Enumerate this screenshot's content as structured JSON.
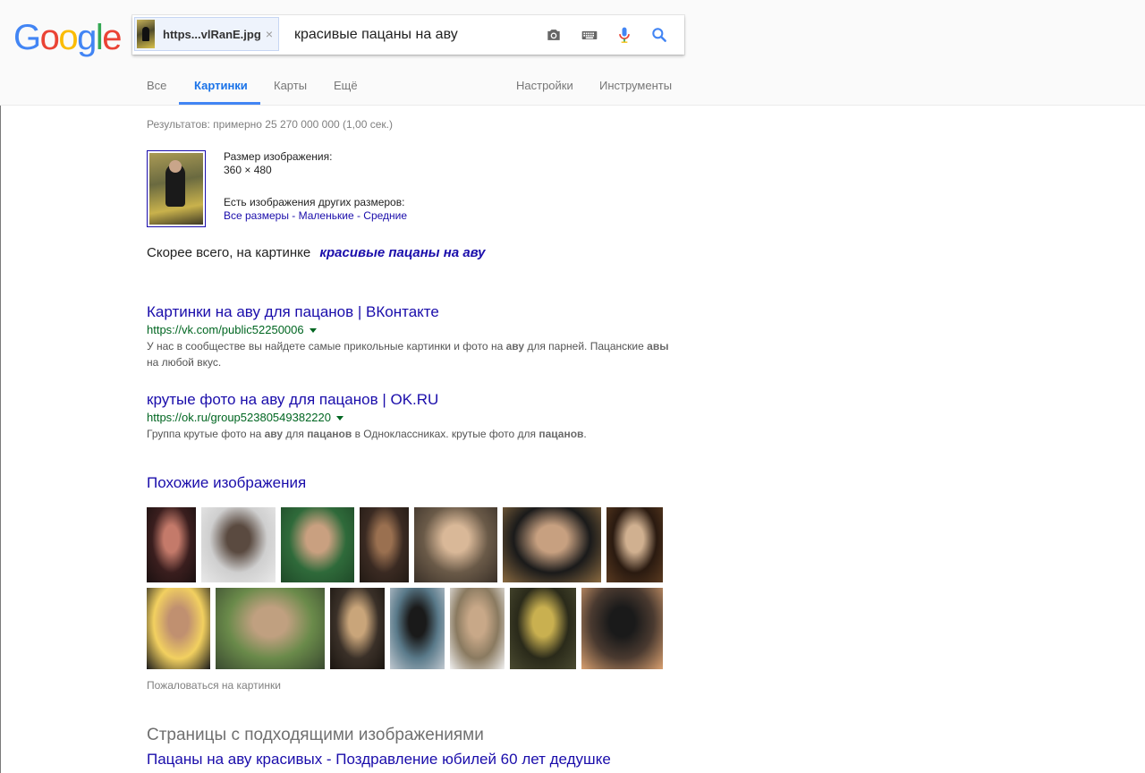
{
  "logo": {
    "letters": [
      {
        "ch": "G",
        "color": "#4285F4"
      },
      {
        "ch": "o",
        "color": "#EA4335"
      },
      {
        "ch": "o",
        "color": "#FBBC05"
      },
      {
        "ch": "g",
        "color": "#4285F4"
      },
      {
        "ch": "l",
        "color": "#34A853"
      },
      {
        "ch": "e",
        "color": "#EA4335"
      }
    ]
  },
  "search": {
    "image_chip": "https...vlRanE.jpg",
    "chip_close": "×",
    "query": "красивые пацаны на аву",
    "icons": [
      "camera-icon",
      "keyboard-icon",
      "microphone-icon",
      "search-icon"
    ]
  },
  "tabs": {
    "all": "Все",
    "images": "Картинки",
    "maps": "Карты",
    "more": "Ещё",
    "settings": "Настройки",
    "tools": "Инструменты"
  },
  "stats": "Результатов: примерно 25 270 000 000 (1,00 сек.)",
  "image_info": {
    "size_label": "Размер изображения:",
    "size_value": "360 × 480",
    "other_sizes_label": "Есть изображения других размеров:",
    "links": [
      "Все размеры",
      "Маленькие",
      "Средние"
    ],
    "separator": " - "
  },
  "best_guess": {
    "prefix": "Скорее всего, на картинке",
    "query_link": "красивые пацаны на аву"
  },
  "results": [
    {
      "title": "Картинки на аву для пацанов | ВКонтакте",
      "url": "https://vk.com/public52250006",
      "snippet_parts": [
        {
          "t": "У нас в сообществе вы найдете самые прикольные картинки и фото на ",
          "b": false
        },
        {
          "t": "аву",
          "b": true
        },
        {
          "t": " для парней. Пацанские ",
          "b": false
        },
        {
          "t": "авы",
          "b": true
        },
        {
          "t": " на любой вкус.",
          "b": false
        }
      ]
    },
    {
      "title": "крутые фото на аву для пацанов | OK.RU",
      "url": "https://ok.ru/group52380549382220",
      "snippet_parts": [
        {
          "t": "Группа крутые фото на ",
          "b": false
        },
        {
          "t": "аву",
          "b": true
        },
        {
          "t": " для ",
          "b": false
        },
        {
          "t": "пацанов",
          "b": true
        },
        {
          "t": " в Одноклассниках. крутые фото для ",
          "b": false
        },
        {
          "t": "пацанов",
          "b": true
        },
        {
          "t": ".",
          "b": false
        }
      ]
    }
  ],
  "similar": {
    "heading": "Похожие изображения",
    "report": "Пожаловаться на картинки"
  },
  "pages": {
    "heading": "Страницы с подходящими изображениями",
    "first_title": "Пацаны на аву красивых - Поздравление юбилей 60 лет дедушке"
  },
  "colors": {
    "link": "#1a0dab",
    "url_green": "#006621",
    "accent_blue": "#4285f4"
  }
}
